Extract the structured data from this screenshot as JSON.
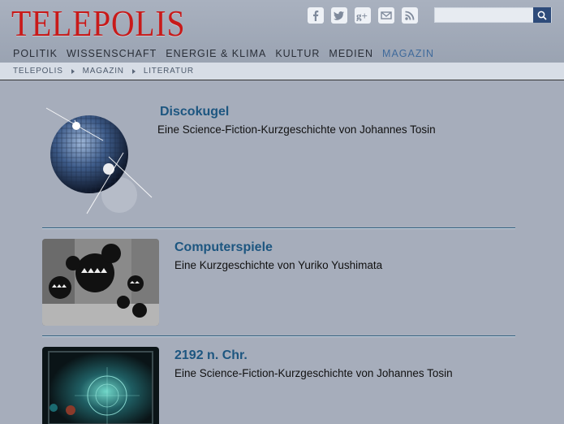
{
  "header": {
    "logo": "TELEPOLIS",
    "social": [
      "facebook-icon",
      "twitter-icon",
      "googleplus-icon",
      "mail-icon",
      "rss-icon"
    ],
    "search": {
      "placeholder": ""
    },
    "nav": [
      "POLITIK",
      "WISSENSCHAFT",
      "ENERGIE & KLIMA",
      "KULTUR",
      "MEDIEN",
      "MAGAZIN"
    ],
    "active_nav": "MAGAZIN"
  },
  "breadcrumb": [
    "TELEPOLIS",
    "MAGAZIN",
    "LITERATUR"
  ],
  "articles": [
    {
      "title": "Discokugel",
      "subtitle": "Eine Science-Fiction-Kurzgeschichte von Johannes Tosin"
    },
    {
      "title": "Computerspiele",
      "subtitle": "Eine Kurzgeschichte von Yuriko Yushimata"
    },
    {
      "title": "2192 n. Chr.",
      "subtitle": "Eine Science-Fiction-Kurzgeschichte von Johannes Tosin"
    }
  ],
  "colors": {
    "logo": "#c81a1a",
    "accent": "#1d5680",
    "active_nav": "#3f6a9b",
    "background": "#a6adbb"
  }
}
